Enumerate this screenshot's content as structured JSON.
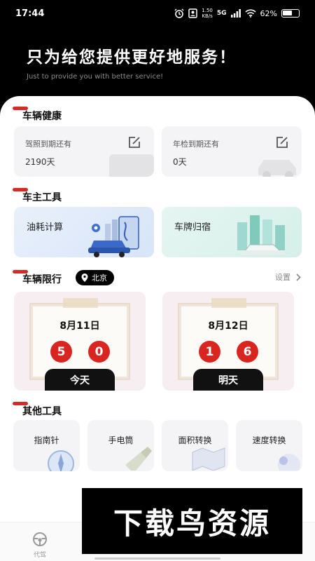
{
  "status": {
    "time": "17:44",
    "speed_top": "1.50",
    "speed_bottom": "KB/s",
    "network": "5G",
    "battery_text": "62%",
    "battery_level": 0.62
  },
  "hero": {
    "title": "只为给您提供更好地服务！",
    "subtitle": "Just to provide you with better service!"
  },
  "health": {
    "title": "车辆健康",
    "license": {
      "label": "驾照到期还有",
      "value": "2190天"
    },
    "inspection": {
      "label": "年检到期还有",
      "value": "0天"
    }
  },
  "owner_tools": {
    "title": "车主工具",
    "fuel": "油耗计算",
    "plate": "车牌归宿"
  },
  "limit": {
    "title": "车辆限行",
    "city": "北京",
    "settings": "设置",
    "today": {
      "date": "8月11日",
      "nums": [
        "5",
        "0"
      ],
      "tab": "今天"
    },
    "tomorrow": {
      "date": "8月12日",
      "nums": [
        "1",
        "6"
      ],
      "tab": "明天"
    }
  },
  "other_tools": {
    "title": "其他工具",
    "items": [
      "指南针",
      "手电筒",
      "面积转换",
      "速度转换"
    ]
  },
  "tabbar": {
    "drive_label": "代驾"
  },
  "banner": {
    "text": "下载鸟资源"
  },
  "colors": {
    "accent": "#d62a26",
    "dark": "#000000",
    "card": "#f4f4f6"
  }
}
